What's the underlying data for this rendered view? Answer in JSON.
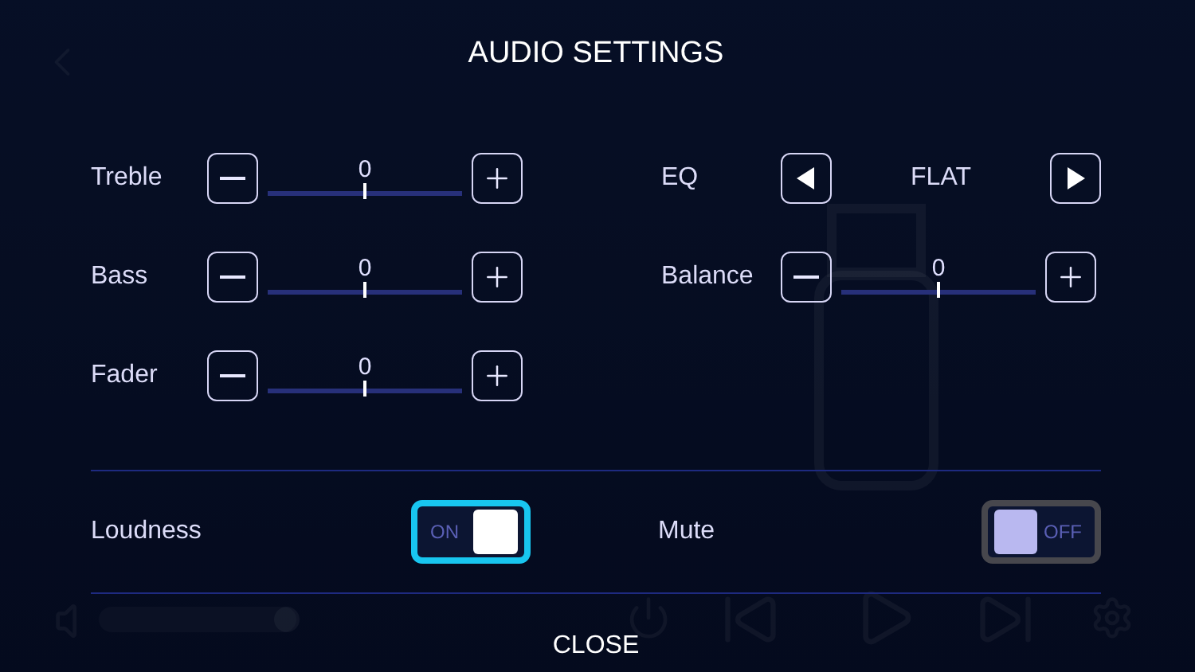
{
  "background": {
    "volume": {
      "level": 0.95
    }
  },
  "dialog": {
    "title": "AUDIO SETTINGS",
    "left_controls": [
      {
        "label": "Treble",
        "value": "0",
        "level": 0.5
      },
      {
        "label": "Bass",
        "value": "0",
        "level": 0.5
      },
      {
        "label": "Fader",
        "value": "0",
        "level": 0.5
      }
    ],
    "eq": {
      "label": "EQ",
      "value": "FLAT"
    },
    "balance": {
      "label": "Balance",
      "value": "0",
      "level": 0.5
    },
    "toggles": [
      {
        "label": "Loudness",
        "on": true,
        "state_text": "ON"
      },
      {
        "label": "Mute",
        "on": false,
        "state_text": "OFF"
      }
    ],
    "close": "CLOSE"
  }
}
